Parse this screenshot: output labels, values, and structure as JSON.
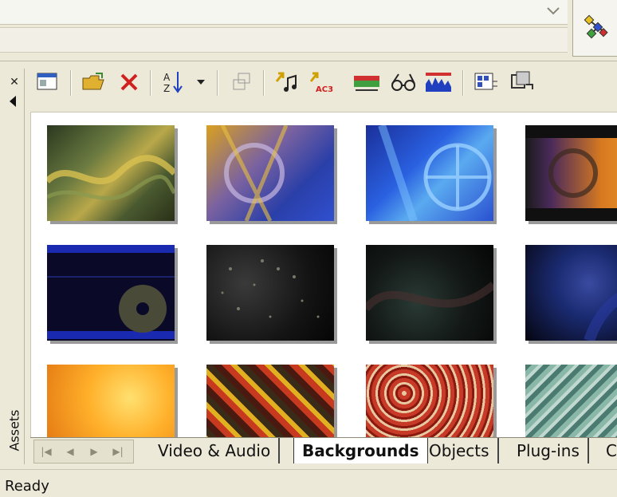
{
  "window": {
    "side_label": "Assets",
    "status": "Ready"
  },
  "toolbar": {
    "buttons": [
      "panel-view",
      "open-folder",
      "delete",
      "sort-az",
      "sort-dropdown",
      "copy-disabled",
      "import-audio",
      "import-ac3",
      "timeline-range",
      "preview-glasses",
      "waveform",
      "properties",
      "render-clip"
    ]
  },
  "tabs": [
    {
      "label": "Video & Audio",
      "active": false
    },
    {
      "label": "Backgrounds",
      "active": true
    },
    {
      "label": "Objects",
      "active": false
    },
    {
      "label": "Plug-ins",
      "active": false
    },
    {
      "label": "C",
      "active": false
    }
  ],
  "thumbnails": [
    {
      "name": "bg-olive-swirl",
      "colors": [
        "#3c4a2c",
        "#6a7a40",
        "#b9a84a"
      ]
    },
    {
      "name": "bg-yellow-blue-film",
      "colors": [
        "#2a3fa8",
        "#d9b030",
        "#7a62a0"
      ]
    },
    {
      "name": "bg-blue-reels",
      "colors": [
        "#2a50d0",
        "#5aaaf0",
        "#1a2f9a"
      ]
    },
    {
      "name": "bg-orange-reels",
      "colors": [
        "#1a1a1a",
        "#d87a20",
        "#7a4090"
      ]
    },
    {
      "name": "bg-disc-blue-bars",
      "colors": [
        "#0a0a28",
        "#1a2aa8",
        "#6a6a50"
      ]
    },
    {
      "name": "bg-dark-speckles",
      "colors": [
        "#0d0d0d",
        "#303030",
        "#5a5a5a"
      ]
    },
    {
      "name": "bg-dark-wave",
      "colors": [
        "#070707",
        "#2a3a30",
        "#403030"
      ]
    },
    {
      "name": "bg-dark-blue-sphere",
      "colors": [
        "#05050f",
        "#1a2a70",
        "#3a4aa0"
      ]
    },
    {
      "name": "bg-orange-glow",
      "colors": [
        "#e07010",
        "#ffb02a",
        "#ffe070"
      ]
    },
    {
      "name": "bg-autumn-leaves",
      "colors": [
        "#4a1a10",
        "#c83a20",
        "#e0b020"
      ]
    },
    {
      "name": "bg-red-pattern",
      "colors": [
        "#8a1a10",
        "#d84030",
        "#e8c8a0"
      ]
    },
    {
      "name": "bg-green-texture",
      "colors": [
        "#4a7a70",
        "#8ab8a8",
        "#c0d8d0"
      ]
    }
  ]
}
